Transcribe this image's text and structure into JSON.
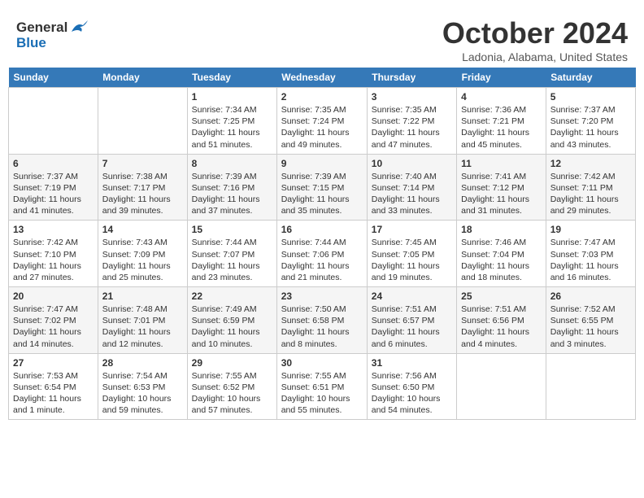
{
  "header": {
    "logo_line1": "General",
    "logo_line2": "Blue",
    "month": "October 2024",
    "location": "Ladonia, Alabama, United States"
  },
  "days_of_week": [
    "Sunday",
    "Monday",
    "Tuesday",
    "Wednesday",
    "Thursday",
    "Friday",
    "Saturday"
  ],
  "weeks": [
    [
      {
        "day": "",
        "info": ""
      },
      {
        "day": "",
        "info": ""
      },
      {
        "day": "1",
        "info": "Sunrise: 7:34 AM\nSunset: 7:25 PM\nDaylight: 11 hours and 51 minutes."
      },
      {
        "day": "2",
        "info": "Sunrise: 7:35 AM\nSunset: 7:24 PM\nDaylight: 11 hours and 49 minutes."
      },
      {
        "day": "3",
        "info": "Sunrise: 7:35 AM\nSunset: 7:22 PM\nDaylight: 11 hours and 47 minutes."
      },
      {
        "day": "4",
        "info": "Sunrise: 7:36 AM\nSunset: 7:21 PM\nDaylight: 11 hours and 45 minutes."
      },
      {
        "day": "5",
        "info": "Sunrise: 7:37 AM\nSunset: 7:20 PM\nDaylight: 11 hours and 43 minutes."
      }
    ],
    [
      {
        "day": "6",
        "info": "Sunrise: 7:37 AM\nSunset: 7:19 PM\nDaylight: 11 hours and 41 minutes."
      },
      {
        "day": "7",
        "info": "Sunrise: 7:38 AM\nSunset: 7:17 PM\nDaylight: 11 hours and 39 minutes."
      },
      {
        "day": "8",
        "info": "Sunrise: 7:39 AM\nSunset: 7:16 PM\nDaylight: 11 hours and 37 minutes."
      },
      {
        "day": "9",
        "info": "Sunrise: 7:39 AM\nSunset: 7:15 PM\nDaylight: 11 hours and 35 minutes."
      },
      {
        "day": "10",
        "info": "Sunrise: 7:40 AM\nSunset: 7:14 PM\nDaylight: 11 hours and 33 minutes."
      },
      {
        "day": "11",
        "info": "Sunrise: 7:41 AM\nSunset: 7:12 PM\nDaylight: 11 hours and 31 minutes."
      },
      {
        "day": "12",
        "info": "Sunrise: 7:42 AM\nSunset: 7:11 PM\nDaylight: 11 hours and 29 minutes."
      }
    ],
    [
      {
        "day": "13",
        "info": "Sunrise: 7:42 AM\nSunset: 7:10 PM\nDaylight: 11 hours and 27 minutes."
      },
      {
        "day": "14",
        "info": "Sunrise: 7:43 AM\nSunset: 7:09 PM\nDaylight: 11 hours and 25 minutes."
      },
      {
        "day": "15",
        "info": "Sunrise: 7:44 AM\nSunset: 7:07 PM\nDaylight: 11 hours and 23 minutes."
      },
      {
        "day": "16",
        "info": "Sunrise: 7:44 AM\nSunset: 7:06 PM\nDaylight: 11 hours and 21 minutes."
      },
      {
        "day": "17",
        "info": "Sunrise: 7:45 AM\nSunset: 7:05 PM\nDaylight: 11 hours and 19 minutes."
      },
      {
        "day": "18",
        "info": "Sunrise: 7:46 AM\nSunset: 7:04 PM\nDaylight: 11 hours and 18 minutes."
      },
      {
        "day": "19",
        "info": "Sunrise: 7:47 AM\nSunset: 7:03 PM\nDaylight: 11 hours and 16 minutes."
      }
    ],
    [
      {
        "day": "20",
        "info": "Sunrise: 7:47 AM\nSunset: 7:02 PM\nDaylight: 11 hours and 14 minutes."
      },
      {
        "day": "21",
        "info": "Sunrise: 7:48 AM\nSunset: 7:01 PM\nDaylight: 11 hours and 12 minutes."
      },
      {
        "day": "22",
        "info": "Sunrise: 7:49 AM\nSunset: 6:59 PM\nDaylight: 11 hours and 10 minutes."
      },
      {
        "day": "23",
        "info": "Sunrise: 7:50 AM\nSunset: 6:58 PM\nDaylight: 11 hours and 8 minutes."
      },
      {
        "day": "24",
        "info": "Sunrise: 7:51 AM\nSunset: 6:57 PM\nDaylight: 11 hours and 6 minutes."
      },
      {
        "day": "25",
        "info": "Sunrise: 7:51 AM\nSunset: 6:56 PM\nDaylight: 11 hours and 4 minutes."
      },
      {
        "day": "26",
        "info": "Sunrise: 7:52 AM\nSunset: 6:55 PM\nDaylight: 11 hours and 3 minutes."
      }
    ],
    [
      {
        "day": "27",
        "info": "Sunrise: 7:53 AM\nSunset: 6:54 PM\nDaylight: 11 hours and 1 minute."
      },
      {
        "day": "28",
        "info": "Sunrise: 7:54 AM\nSunset: 6:53 PM\nDaylight: 10 hours and 59 minutes."
      },
      {
        "day": "29",
        "info": "Sunrise: 7:55 AM\nSunset: 6:52 PM\nDaylight: 10 hours and 57 minutes."
      },
      {
        "day": "30",
        "info": "Sunrise: 7:55 AM\nSunset: 6:51 PM\nDaylight: 10 hours and 55 minutes."
      },
      {
        "day": "31",
        "info": "Sunrise: 7:56 AM\nSunset: 6:50 PM\nDaylight: 10 hours and 54 minutes."
      },
      {
        "day": "",
        "info": ""
      },
      {
        "day": "",
        "info": ""
      }
    ]
  ]
}
